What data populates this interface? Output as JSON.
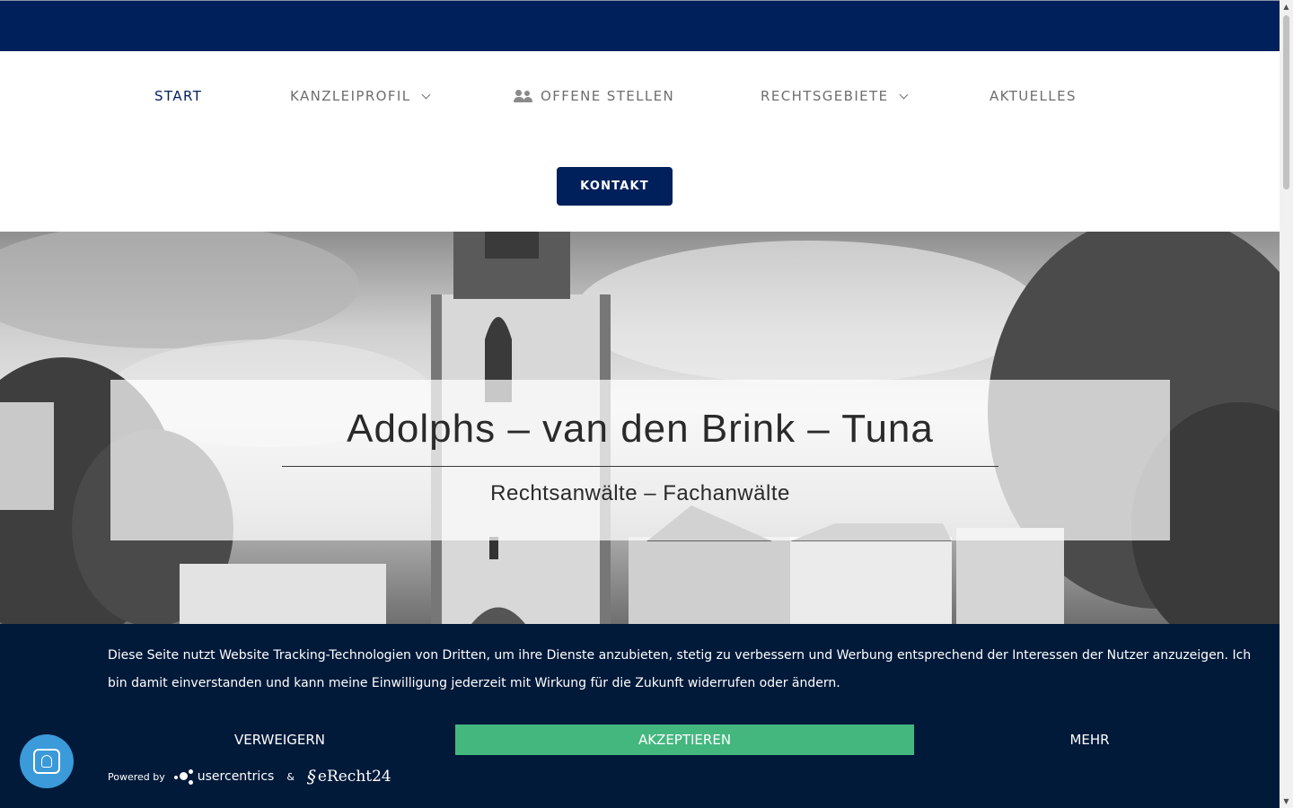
{
  "nav": {
    "items": [
      {
        "label": "START"
      },
      {
        "label": "KANZLEIPROFIL"
      },
      {
        "label": "OFFENE STELLEN"
      },
      {
        "label": "RECHTSGEBIETE"
      },
      {
        "label": "AKTUELLES"
      }
    ],
    "contact_label": "KONTAKT"
  },
  "hero": {
    "title": "Adolphs – van den Brink – Tuna",
    "subtitle": "Rechtsanwälte – Fachanwälte"
  },
  "cookie": {
    "text": "Diese Seite nutzt Website Tracking-Technologien von Dritten, um ihre Dienste anzubieten, stetig zu verbessern und Werbung entsprechend der Interessen der Nutzer anzuzeigen. Ich bin damit einverstanden und kann meine Einwilligung jederzeit mit Wirkung für die Zukunft widerrufen oder ändern.",
    "deny_label": "VERWEIGERN",
    "accept_label": "AKZEPTIEREN",
    "more_label": "MEHR",
    "powered_by": "Powered by",
    "usercentrics": "usercentrics",
    "ampersand": "&",
    "erecht": "eRecht24"
  },
  "colors": {
    "brand": "#00205b",
    "accept": "#44b77f",
    "banner": "#021a3a",
    "chat": "#3b9ad9"
  }
}
